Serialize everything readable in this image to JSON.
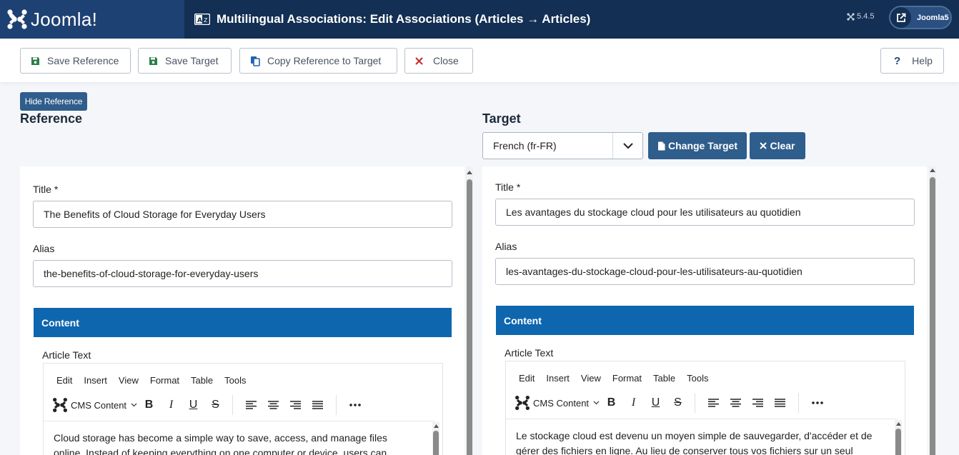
{
  "header": {
    "logo_text": "Joomla!",
    "page_title": "Multilingual Associations: Edit Associations (Articles → Articles)",
    "version": "5.4.5",
    "user_label": "Joomla5"
  },
  "toolbar": {
    "save_reference": "Save Reference",
    "save_target": "Save Target",
    "copy_reference": "Copy Reference to Target",
    "close": "Close",
    "help": "Help"
  },
  "reference": {
    "hide_button": "Hide Reference",
    "heading": "Reference",
    "title_label": "Title *",
    "title_value": "The Benefits of Cloud Storage for Everyday Users",
    "alias_label": "Alias",
    "alias_value": "the-benefits-of-cloud-storage-for-everyday-users",
    "content_tab": "Content",
    "article_text_label": "Article Text",
    "body_line1": "Cloud storage has become a simple way to save, access, and manage files",
    "body_line2": "online. Instead of keeping everything on one computer or device, users can"
  },
  "target": {
    "heading": "Target",
    "language_selected": "French (fr-FR)",
    "change_target": "Change Target",
    "clear": "Clear",
    "title_label": "Title *",
    "title_value": "Les avantages du stockage cloud pour les utilisateurs au quotidien",
    "alias_label": "Alias",
    "alias_value": "les-avantages-du-stockage-cloud-pour-les-utilisateurs-au-quotidien",
    "content_tab": "Content",
    "article_text_label": "Article Text",
    "body_line1": "Le stockage cloud est devenu un moyen simple de sauvegarder, d'accéder et de",
    "body_line2": "gérer des fichiers en ligne. Au lieu de conserver tous vos fichiers sur un seul"
  },
  "editor": {
    "menus": [
      "Edit",
      "Insert",
      "View",
      "Format",
      "Table",
      "Tools"
    ],
    "cms_content": "CMS Content"
  },
  "colors": {
    "header_bg": "#132f53",
    "accent_blue": "#2f5d8c",
    "content_tab": "#0e66ae"
  }
}
